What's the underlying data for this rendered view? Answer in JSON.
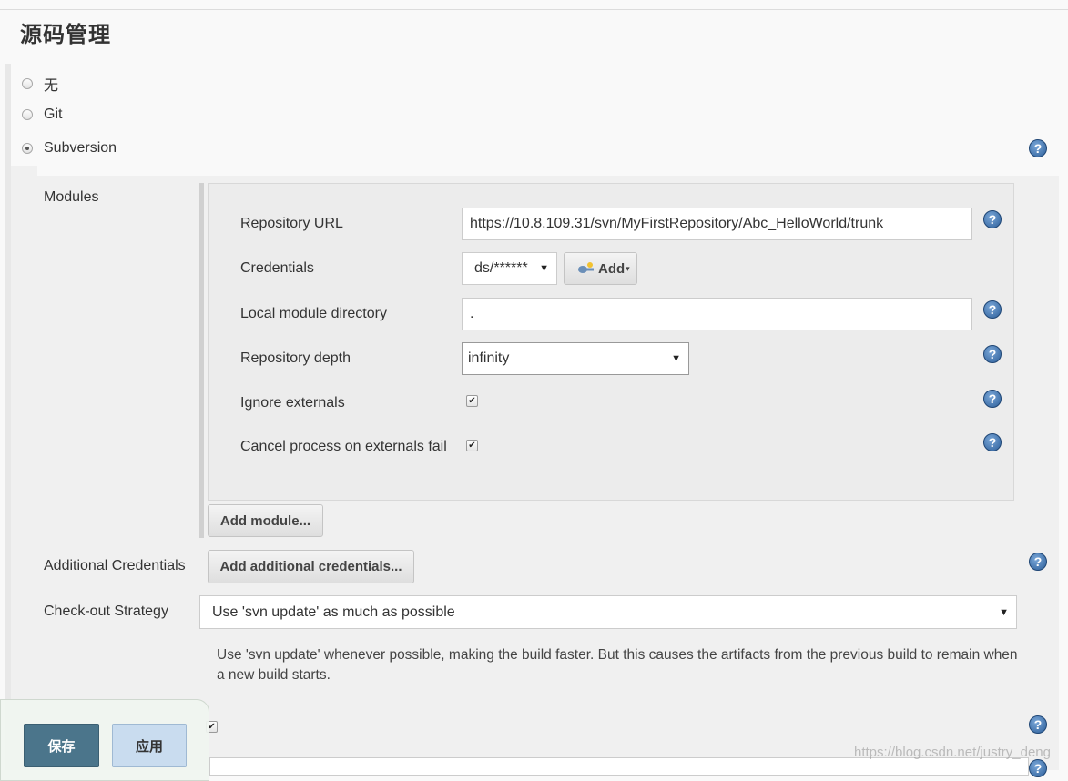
{
  "section": {
    "title": "源码管理"
  },
  "scm_options": [
    {
      "label": "无",
      "checked": false
    },
    {
      "label": "Git",
      "checked": false
    },
    {
      "label": "Subversion",
      "checked": true
    }
  ],
  "modules": {
    "label": "Modules",
    "repository_url": {
      "label": "Repository URL",
      "value": "https://10.8.109.31/svn/MyFirstRepository/Abc_HelloWorld/trunk"
    },
    "credentials": {
      "label": "Credentials",
      "value": "ds/******",
      "add_label": "Add"
    },
    "local_module_directory": {
      "label": "Local module directory",
      "value": "."
    },
    "repository_depth": {
      "label": "Repository depth",
      "value": "infinity"
    },
    "ignore_externals": {
      "label": "Ignore externals",
      "checked": true
    },
    "cancel_process": {
      "label": "Cancel process on externals fail",
      "checked": true
    },
    "add_module_label": "Add module..."
  },
  "additional_credentials": {
    "label": "Additional Credentials",
    "button_label": "Add additional credentials..."
  },
  "checkout_strategy": {
    "label": "Check-out Strategy",
    "value": "Use 'svn update' as much as possible",
    "description": "Use 'svn update' whenever possible, making the build faster. But this causes the artifacts from the previous build to remain when a new build starts."
  },
  "footer": {
    "save_label": "保存",
    "apply_label": "应用"
  },
  "watermark": "https://blog.csdn.net/justry_deng",
  "icons": {
    "help": "help-icon",
    "add": "key-add-icon"
  },
  "colors": {
    "save_bg": "#4b758b",
    "apply_bg": "#c9dcef",
    "help_blue": "#2d5f9a"
  }
}
